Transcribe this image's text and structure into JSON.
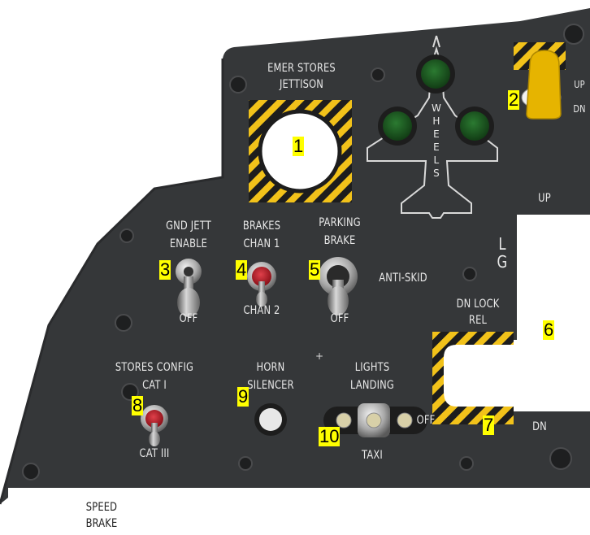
{
  "panel": {
    "emer_stores_line1": "EMER STORES",
    "emer_stores_line2": "JETTISON",
    "wheels": [
      "W",
      "H",
      "E",
      "E",
      "L",
      "S"
    ],
    "gear_up": "UP",
    "gear_dn": "DN",
    "lg_up": "UP",
    "lg_l": "L",
    "lg_g": "G",
    "dn_lock_line1": "DN LOCK",
    "dn_lock_line2": "REL",
    "lg_dn": "DN",
    "gnd_jett_line1": "GND  JETT",
    "gnd_jett_line2": "ENABLE",
    "gnd_jett_off": "OFF",
    "brakes_line1": "BRAKES",
    "brakes_line2": "CHAN 1",
    "brakes_chan2": "CHAN 2",
    "parking_line1": "PARKING",
    "parking_line2": "BRAKE",
    "anti_skid": "ANTI-SKID",
    "parking_off": "OFF",
    "stores_config_line1": "STORES  CONFIG",
    "stores_config_line2": "CAT  I",
    "stores_config_cat3": "CAT  III",
    "horn_line1": "HORN",
    "horn_line2": "SILENCER",
    "lights_line1": "LIGHTS",
    "lights_line2": "LANDING",
    "lights_off": "OFF",
    "lights_taxi": "TAXI",
    "speed_line1": "SPEED",
    "speed_line2": "BRAKE"
  },
  "callouts": [
    "1",
    "2",
    "3",
    "4",
    "5",
    "6",
    "7",
    "8",
    "9",
    "10"
  ],
  "colors": {
    "panel": "#353739",
    "hazard_yellow": "#f2c21a",
    "indicator_green": "#1f5c24",
    "gear_handle": "#e6b400",
    "toggle_red": "#c0202a",
    "label": "#e8e8e8",
    "callout_bg": "#ffff00"
  }
}
